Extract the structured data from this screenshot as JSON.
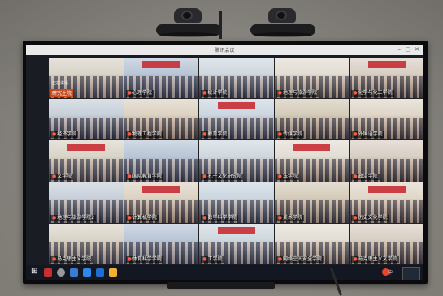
{
  "window": {
    "title": "腾讯会议"
  },
  "first_tile": {
    "top_text": "正在讲话",
    "label": "研究生院"
  },
  "tiles": [
    {
      "label": "",
      "special": true
    },
    {
      "label": "心理学院"
    },
    {
      "label": "统计学院"
    },
    {
      "label": "地理与旅游学院"
    },
    {
      "label": "化学与化工学院"
    },
    {
      "label": "经济学院"
    },
    {
      "label": "物理工程学院"
    },
    {
      "label": "教育学院"
    },
    {
      "label": "传媒学院"
    },
    {
      "label": "外国语学院"
    },
    {
      "label": "文学院"
    },
    {
      "label": "国际教育学院"
    },
    {
      "label": "孔子文化研究院"
    },
    {
      "label": "法学院"
    },
    {
      "label": "政治学院"
    },
    {
      "label": "地理与旅游学院2"
    },
    {
      "label": "计算机学院"
    },
    {
      "label": "数学科学学院"
    },
    {
      "label": "美术学院"
    },
    {
      "label": "历史文化学院"
    },
    {
      "label": "马克思主义学院"
    },
    {
      "label": "体育科学学院"
    },
    {
      "label": "工学院"
    },
    {
      "label": "网络空间安全学院"
    },
    {
      "label": "马克思主义文学院"
    }
  ],
  "taskbar": {
    "tray_text": "中"
  },
  "colors": {
    "banner_red": "#c5232a",
    "label_pin": "#ff5a3c",
    "taskbar": "#131722"
  }
}
